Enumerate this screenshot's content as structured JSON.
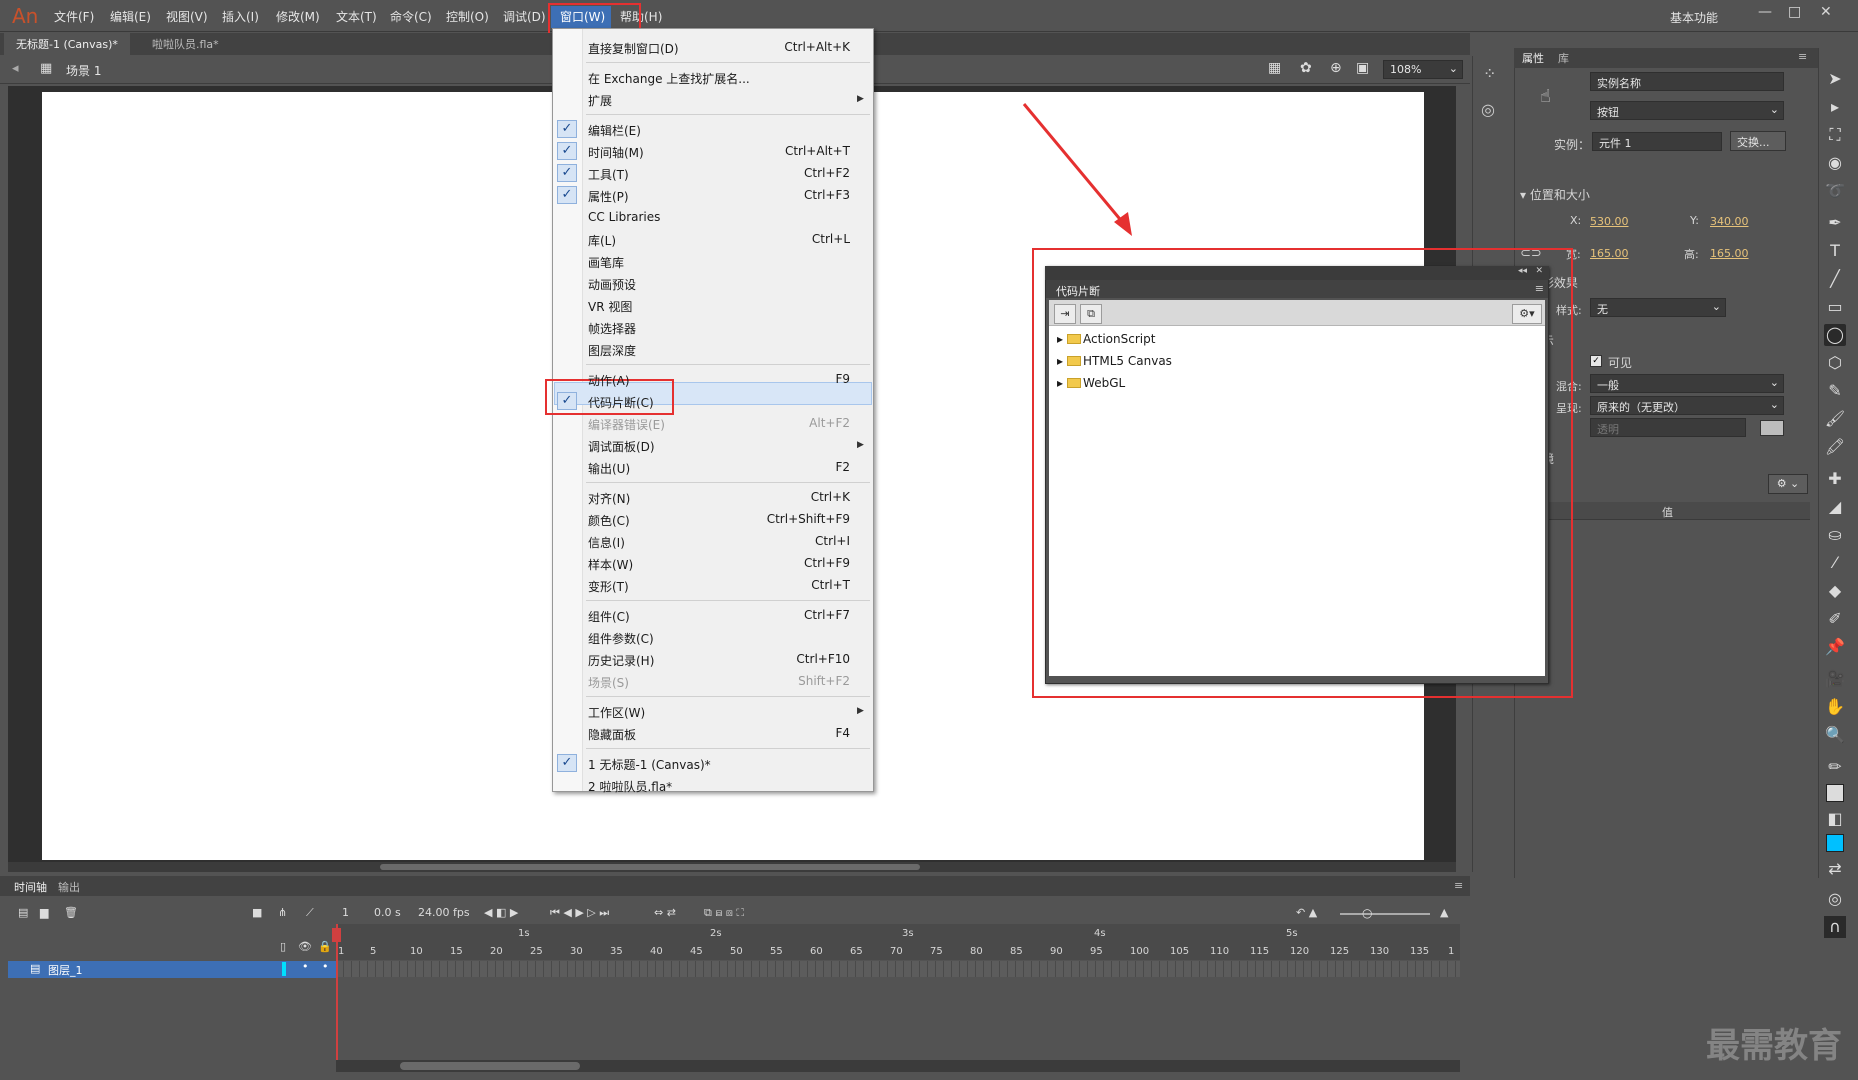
{
  "menubar": {
    "logo": "An",
    "items": [
      "文件(F)",
      "编辑(E)",
      "视图(V)",
      "插入(I)",
      "修改(M)",
      "文本(T)",
      "命令(C)",
      "控制(O)",
      "调试(D)",
      "窗口(W)",
      "帮助(H)"
    ],
    "workspace": "基本功能",
    "win_controls": [
      "—",
      "□",
      "✕"
    ]
  },
  "tabs": [
    "无标题-1 (Canvas)*",
    "啦啦队员.fla*"
  ],
  "scene": {
    "label": "场景 1",
    "zoom": "108%"
  },
  "window_menu": {
    "items": [
      {
        "label": "直接复制窗口(D)",
        "shortcut": "Ctrl+Alt+K",
        "checked": false,
        "disabled": false
      },
      {
        "label": "在 Exchange 上查找扩展名...",
        "shortcut": "",
        "checked": false,
        "disabled": false
      },
      {
        "label": "扩展",
        "shortcut": "",
        "checked": false,
        "disabled": false,
        "submenu": true
      },
      {
        "label": "编辑栏(E)",
        "shortcut": "",
        "checked": true,
        "disabled": false
      },
      {
        "label": "时间轴(M)",
        "shortcut": "Ctrl+Alt+T",
        "checked": true,
        "disabled": false
      },
      {
        "label": "工具(T)",
        "shortcut": "Ctrl+F2",
        "checked": true,
        "disabled": false
      },
      {
        "label": "属性(P)",
        "shortcut": "Ctrl+F3",
        "checked": true,
        "disabled": false
      },
      {
        "label": "CC Libraries",
        "shortcut": "",
        "checked": false,
        "disabled": false
      },
      {
        "label": "库(L)",
        "shortcut": "Ctrl+L",
        "checked": false,
        "disabled": false
      },
      {
        "label": "画笔库",
        "shortcut": "",
        "checked": false,
        "disabled": false
      },
      {
        "label": "动画预设",
        "shortcut": "",
        "checked": false,
        "disabled": false
      },
      {
        "label": "VR 视图",
        "shortcut": "",
        "checked": false,
        "disabled": false
      },
      {
        "label": "帧选择器",
        "shortcut": "",
        "checked": false,
        "disabled": false
      },
      {
        "label": "图层深度",
        "shortcut": "",
        "checked": false,
        "disabled": false
      },
      {
        "label": "动作(A)",
        "shortcut": "F9",
        "checked": false,
        "disabled": false
      },
      {
        "label": "代码片断(C)",
        "shortcut": "",
        "checked": true,
        "disabled": false
      },
      {
        "label": "编译器错误(E)",
        "shortcut": "Alt+F2",
        "checked": false,
        "disabled": true
      },
      {
        "label": "调试面板(D)",
        "shortcut": "",
        "checked": false,
        "disabled": false,
        "submenu": true
      },
      {
        "label": "输出(U)",
        "shortcut": "F2",
        "checked": false,
        "disabled": false
      },
      {
        "label": "对齐(N)",
        "shortcut": "Ctrl+K",
        "checked": false,
        "disabled": false
      },
      {
        "label": "颜色(C)",
        "shortcut": "Ctrl+Shift+F9",
        "checked": false,
        "disabled": false
      },
      {
        "label": "信息(I)",
        "shortcut": "Ctrl+I",
        "checked": false,
        "disabled": false
      },
      {
        "label": "样本(W)",
        "shortcut": "Ctrl+F9",
        "checked": false,
        "disabled": false
      },
      {
        "label": "变形(T)",
        "shortcut": "Ctrl+T",
        "checked": false,
        "disabled": false
      },
      {
        "label": "组件(C)",
        "shortcut": "Ctrl+F7",
        "checked": false,
        "disabled": false
      },
      {
        "label": "组件参数(C)",
        "shortcut": "",
        "checked": false,
        "disabled": false
      },
      {
        "label": "历史记录(H)",
        "shortcut": "Ctrl+F10",
        "checked": false,
        "disabled": false
      },
      {
        "label": "场景(S)",
        "shortcut": "Shift+F2",
        "checked": false,
        "disabled": true
      },
      {
        "label": "工作区(W)",
        "shortcut": "",
        "checked": false,
        "disabled": false,
        "submenu": true
      },
      {
        "label": "隐藏面板",
        "shortcut": "F4",
        "checked": false,
        "disabled": false
      },
      {
        "label": "1 无标题-1 (Canvas)*",
        "shortcut": "",
        "checked": true,
        "disabled": false
      },
      {
        "label": "2 啦啦队员.fla*",
        "shortcut": "",
        "checked": false,
        "disabled": false
      }
    ]
  },
  "snippet_panel": {
    "title": "代码片断",
    "folders": [
      "ActionScript",
      "HTML5 Canvas",
      "WebGL"
    ]
  },
  "props": {
    "tabs": [
      "属性",
      "库"
    ],
    "instance_name": "实例名称",
    "type": "按钮",
    "instance_label": "实例：",
    "instance_value": "元件 1",
    "swap": "交换...",
    "section_pos": "位置和大小",
    "x_label": "X:",
    "x": "530.00",
    "y_label": "Y:",
    "y": "340.00",
    "w_label": "宽:",
    "w": "165.00",
    "h_label": "高:",
    "h": "165.00",
    "section_color": "色彩效果",
    "style_label": "样式:",
    "style": "无",
    "section_display": "显示",
    "visible": "可见",
    "blend_label": "混合:",
    "blend": "一般",
    "render_label": "呈现:",
    "render": "原来的（无更改）",
    "transparent": "透明",
    "section_filter": "滤镜",
    "value_col": "值"
  },
  "timeline": {
    "tabs": [
      "时间轴",
      "输出"
    ],
    "frame": "1",
    "time": "0.0 s",
    "fps": "24.00 fps",
    "seconds": [
      "1s",
      "2s",
      "3s",
      "4s",
      "5s"
    ],
    "frame_numbers": [
      "1",
      "5",
      "10",
      "15",
      "20",
      "25",
      "30",
      "35",
      "40",
      "45",
      "50",
      "55",
      "60",
      "65",
      "70",
      "75",
      "80",
      "85",
      "90",
      "95",
      "100",
      "105",
      "110",
      "115",
      "120",
      "125",
      "130",
      "135",
      "1"
    ],
    "layer": "图层_1"
  },
  "watermark": "最需教育"
}
